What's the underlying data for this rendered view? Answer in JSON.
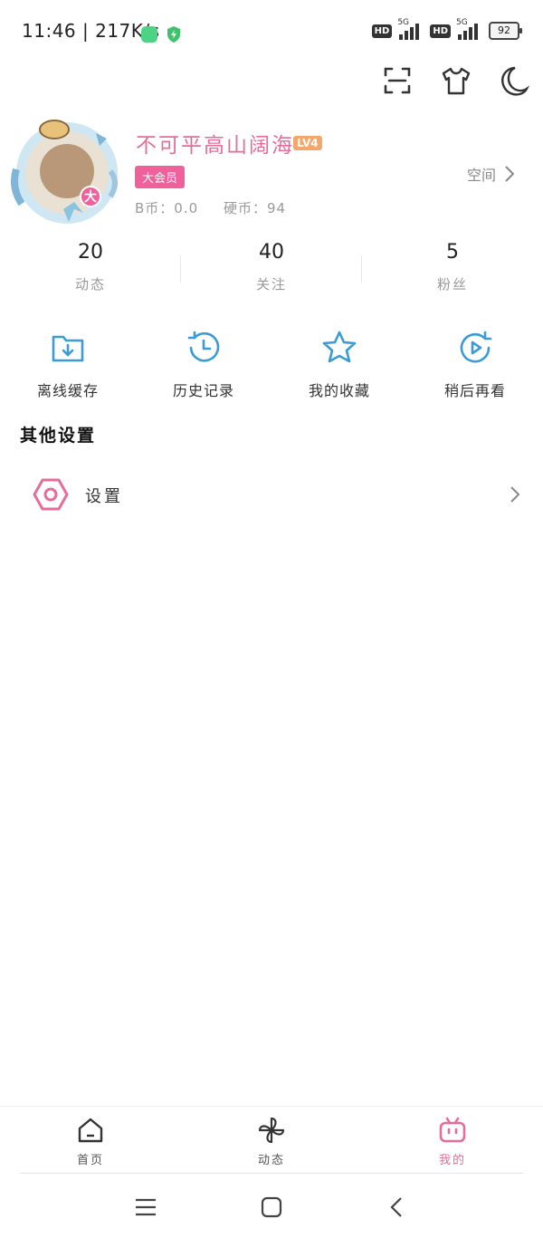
{
  "status_bar": {
    "time": "11:46",
    "speed": "217K/s",
    "network1": "5G",
    "network2": "5G",
    "hd": "HD",
    "battery": "92"
  },
  "top_bar": {
    "icons": [
      "scan-icon",
      "tshirt-icon",
      "moon-icon"
    ]
  },
  "profile": {
    "username": "不可平高山阔海",
    "level": "LV4",
    "vip_badge": "大会员",
    "avatar_badge": "大",
    "space_label": "空间",
    "b_coin": "B币：0.0",
    "coin": "硬币：94"
  },
  "stats": [
    {
      "value": "20",
      "label": "动态"
    },
    {
      "value": "40",
      "label": "关注"
    },
    {
      "value": "5",
      "label": "粉丝"
    }
  ],
  "actions": [
    {
      "label": "离线缓存",
      "icon": "download-folder-icon"
    },
    {
      "label": "历史记录",
      "icon": "history-icon"
    },
    {
      "label": "我的收藏",
      "icon": "star-icon"
    },
    {
      "label": "稍后再看",
      "icon": "watch-later-icon"
    }
  ],
  "other_settings": {
    "title": "其他设置",
    "items": [
      {
        "label": "设置",
        "icon": "settings-hex-icon"
      }
    ]
  },
  "bottom_nav": [
    {
      "label": "首页",
      "icon": "home-icon"
    },
    {
      "label": "动态",
      "icon": "pinwheel-icon"
    },
    {
      "label": "我的",
      "icon": "tv-icon",
      "active": true
    }
  ],
  "colors": {
    "accent_pink": "#e56d99",
    "accent_blue": "#3a9bd5",
    "level_orange": "#f4a76b"
  }
}
